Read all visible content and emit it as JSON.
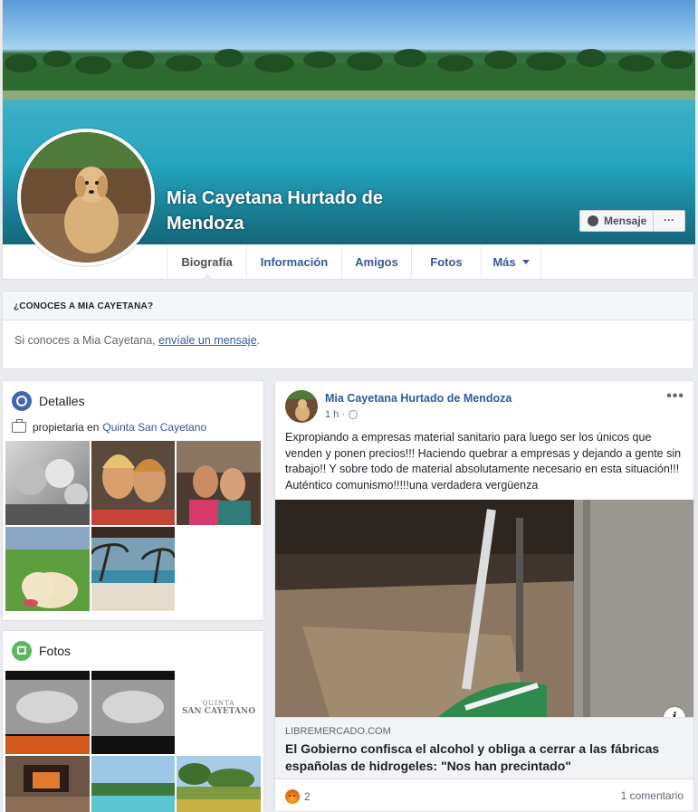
{
  "profile": {
    "name": "Mia Cayetana Hurtado de Mendoza",
    "message_button": "Mensaje",
    "more_button": "···"
  },
  "tabs": [
    {
      "label": "Biografía",
      "active": true
    },
    {
      "label": "Información",
      "active": false
    },
    {
      "label": "Amigos",
      "active": false
    },
    {
      "label": "Fotos",
      "active": false
    },
    {
      "label": "Más",
      "active": false
    }
  ],
  "know": {
    "heading": "¿CONOCES A MIA CAYETANA?",
    "text_before": "Si conoces a Mia Cayetana, ",
    "link": "envíale un mensaje",
    "text_after": "."
  },
  "details": {
    "title": "Detalles",
    "work_prefix": "propietaria en",
    "work_place": "Quinta San Cayetano"
  },
  "photos": {
    "title": "Fotos",
    "logo_line1": "QUINTA",
    "logo_line2": "SAN CAYETANO"
  },
  "post": {
    "author": "Mia Cayetana Hurtado de Mendoza",
    "time": "1 h ·",
    "menu": "•••",
    "text": "Expropiando a empresas material sanitario para luego ser los únicos que venden y ponen precios!!! Haciendo quebrar a empresas y dejando a gente sin trabajo!! Y sobre todo de material absolutamente necesario en esta situación!!! Auténtico comunismo!!!!!una verdadera vergüenza",
    "link_domain": "LIBREMERCADO.COM",
    "link_title": "El Gobierno confisca el alcohol y obliga a cerrar a las fábricas españolas de hidrogeles: \"Nos han precintado\"",
    "info_icon": "i",
    "reaction_count": "2",
    "comments": "1 comentario"
  },
  "colors": {
    "link": "#365899",
    "page_bg": "#e9ebee",
    "card_border": "#dddfe2"
  }
}
